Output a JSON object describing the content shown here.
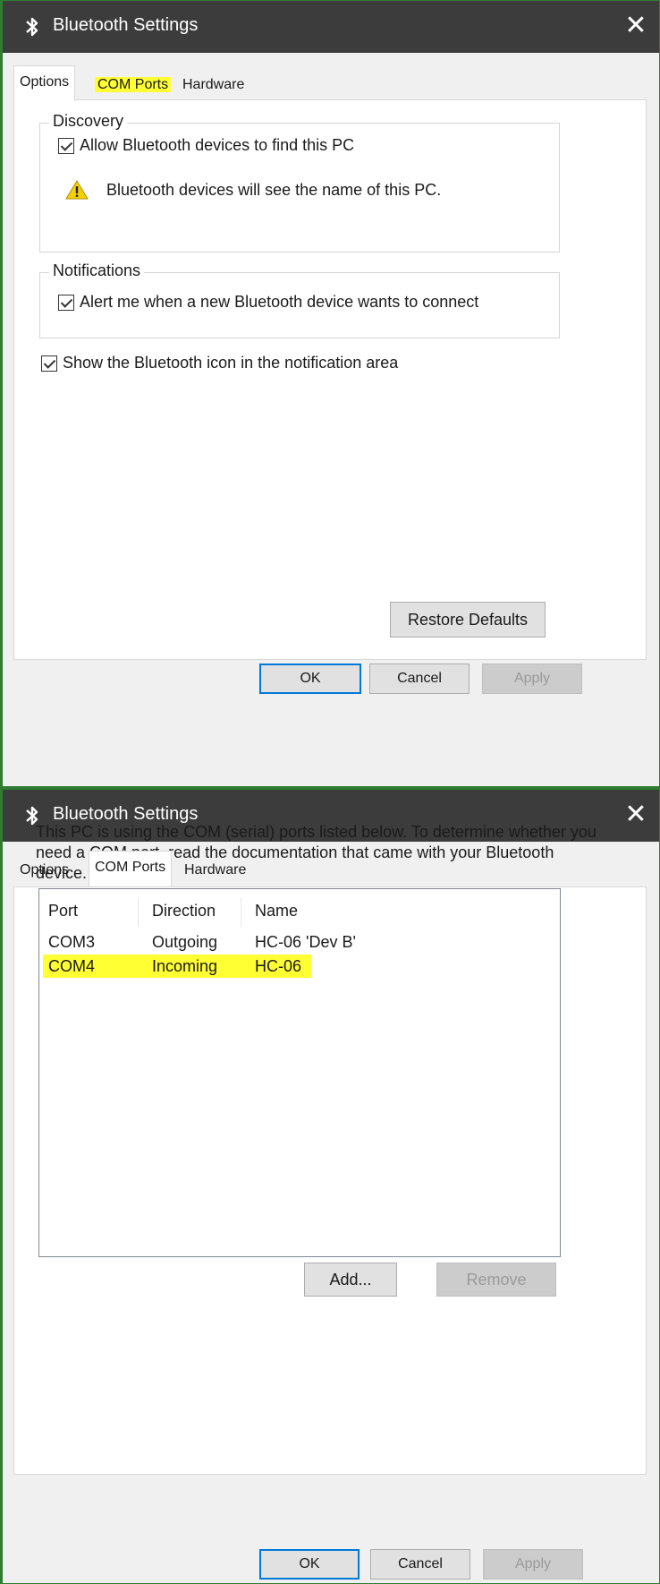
{
  "dialog_options": {
    "title": "Bluetooth Settings",
    "close_glyph": "✕",
    "tabs": [
      {
        "label": "Options",
        "active": true
      },
      {
        "label": "COM Ports",
        "highlighted": true
      },
      {
        "label": "Hardware"
      }
    ],
    "discovery": {
      "legend": "Discovery",
      "allow_label": "Allow Bluetooth devices to find this PC",
      "allow_checked": true,
      "warning_text": "Bluetooth devices will see the name of this PC."
    },
    "notifications": {
      "legend": "Notifications",
      "alert_label": "Alert me when a new Bluetooth device wants to connect",
      "alert_checked": true
    },
    "show_icon_label": "Show the Bluetooth icon in the notification area",
    "show_icon_checked": true,
    "restore_defaults_label": "Restore Defaults",
    "ok_label": "OK",
    "cancel_label": "Cancel",
    "apply_label": "Apply"
  },
  "dialog_com": {
    "title": "Bluetooth Settings",
    "close_glyph": "✕",
    "tabs": [
      {
        "label": "Options"
      },
      {
        "label": "COM Ports",
        "active": true
      },
      {
        "label": "Hardware"
      }
    ],
    "description": "This PC is using the COM (serial) ports listed below. To determine whether you need a COM port, read the documentation that came with your Bluetooth device.",
    "columns": [
      "Port",
      "Direction",
      "Name"
    ],
    "rows": [
      {
        "port": "COM3",
        "direction": "Outgoing",
        "name": "HC-06 'Dev B'"
      },
      {
        "port": "COM4",
        "direction": "Incoming",
        "name": "HC-06",
        "highlighted": true
      }
    ],
    "add_label": "Add...",
    "remove_label": "Remove",
    "ok_label": "OK",
    "cancel_label": "Cancel",
    "apply_label": "Apply"
  },
  "colors": {
    "titlebar": "#3c3c3c",
    "highlight": "#ffff33",
    "frame": "#2e7d32",
    "default_button_border": "#0078d7"
  }
}
